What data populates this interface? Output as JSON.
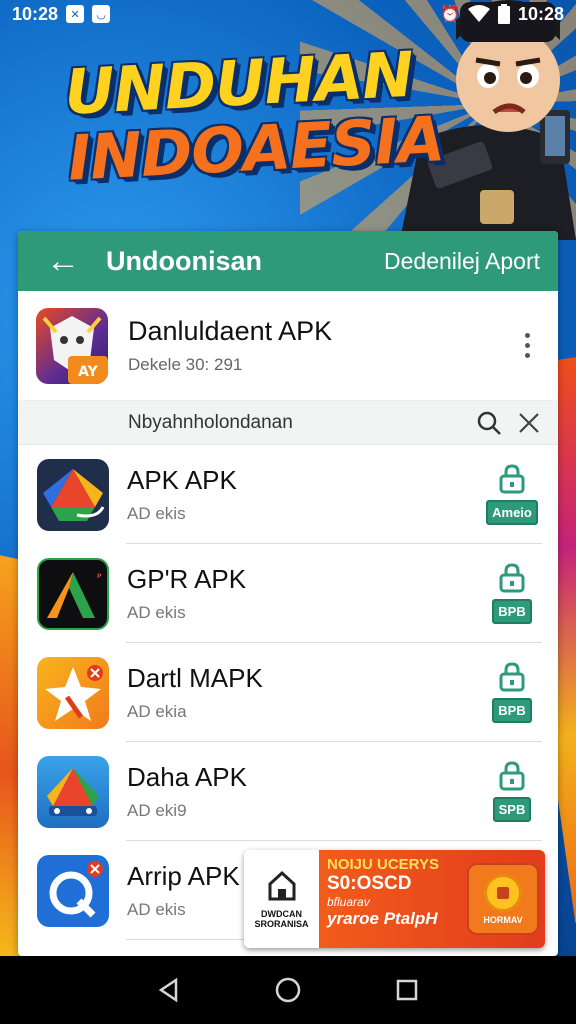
{
  "status_bar": {
    "time_left": "10:28",
    "time_right": "10:28",
    "icons": [
      "notification-x-icon",
      "notification-shield-icon",
      "alarm-icon",
      "wifi-icon",
      "battery-icon"
    ]
  },
  "banner": {
    "line1": "UNDUHAN",
    "line2": "INDOAESIA"
  },
  "app_bar": {
    "back_icon": "back-arrow-icon",
    "title": "Undoonisan",
    "action": "Dedenilej Aport"
  },
  "header": {
    "title": "Danluldaent APK",
    "subtitle": "Dekele 30: 291"
  },
  "search": {
    "text": "Nbyahnholondanan"
  },
  "items": [
    {
      "title": "APK APK",
      "subtitle": "AD ekis",
      "badge": "Ameio"
    },
    {
      "title": "GP'R APK",
      "subtitle": "AD ekis",
      "badge": "BPB"
    },
    {
      "title": "Dartl MAPK",
      "subtitle": "AD ekia",
      "badge": "BPB"
    },
    {
      "title": "Daha APK",
      "subtitle": "AD eki9",
      "badge": "SPB"
    },
    {
      "title": "Arrip APK",
      "subtitle": "AD ekis"
    }
  ],
  "ad": {
    "left_label": "DWDCAN SRORANISA",
    "line1": "NOIJU UCERYS",
    "line2": "S0:OSCD",
    "line3": "bfluarav",
    "line4": "yraroe PtalpH",
    "button_label": "HORMAV"
  },
  "colors": {
    "accent": "#2e9a78",
    "banner_yellow": "#ffd21f",
    "banner_orange": "#f5711d",
    "ad_orange": "#f25c1b"
  }
}
